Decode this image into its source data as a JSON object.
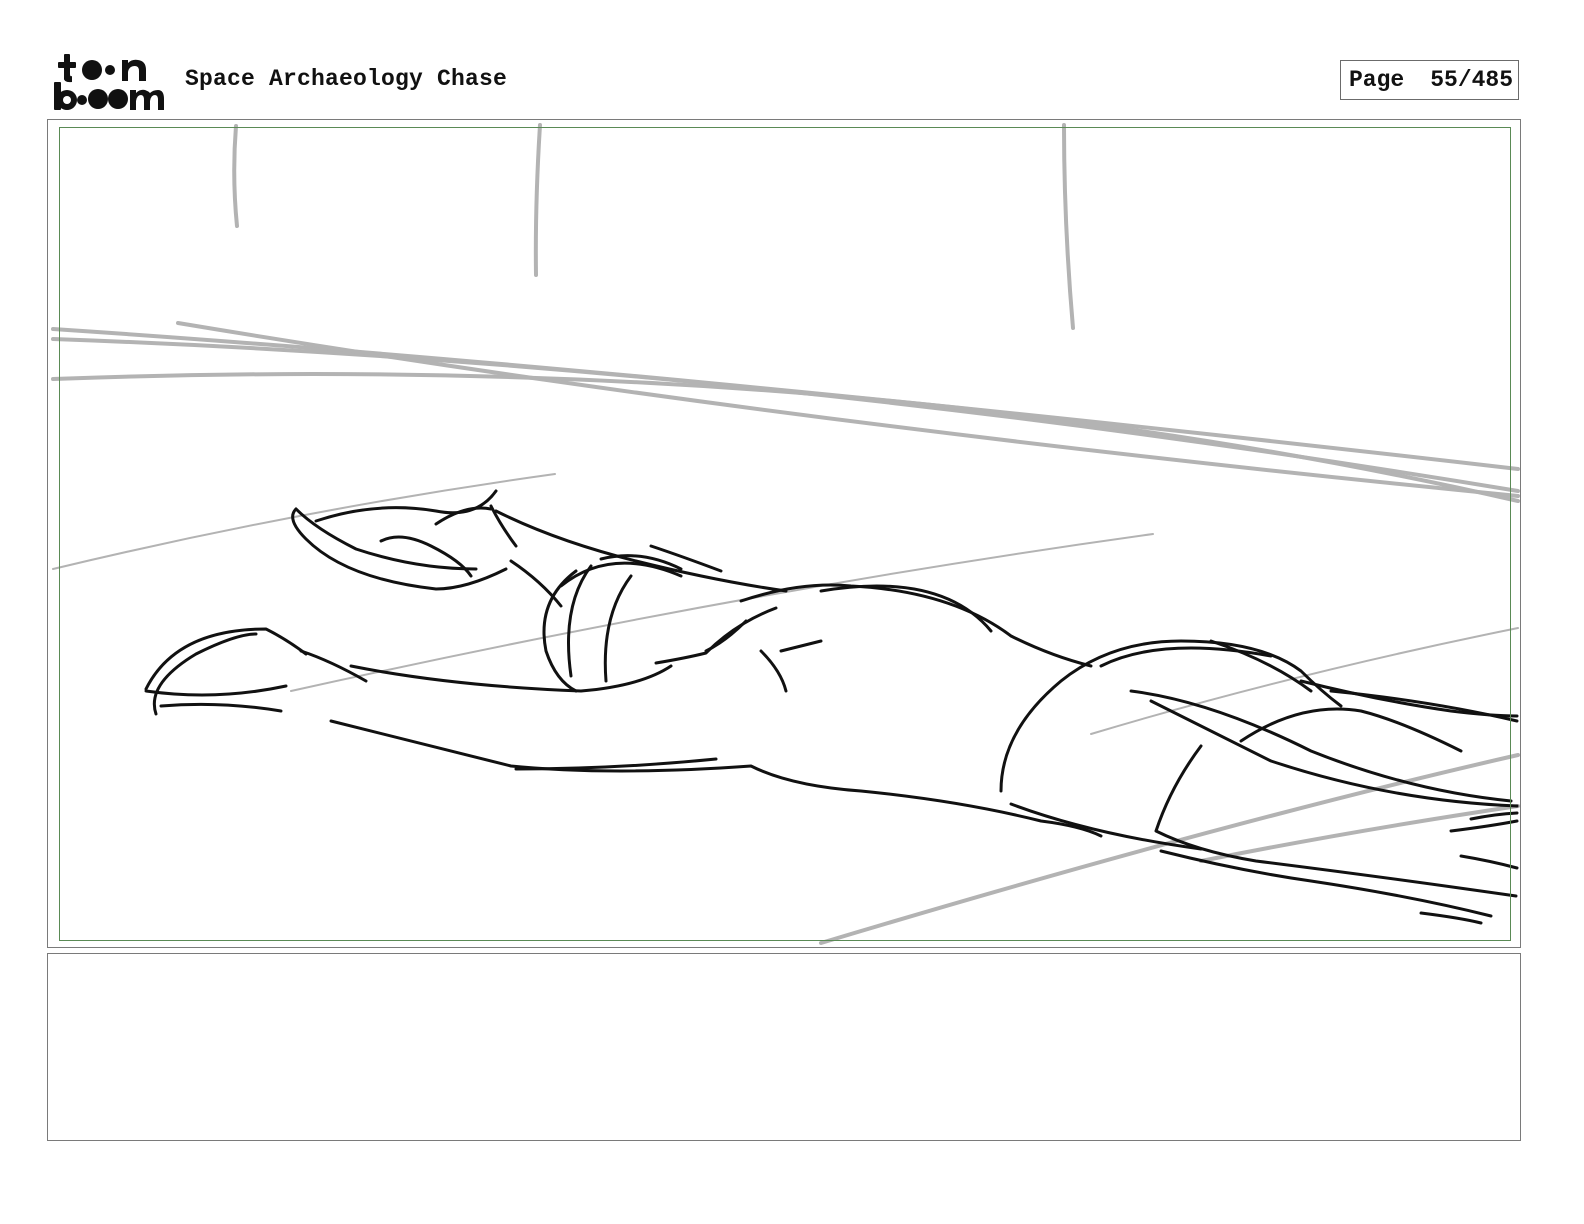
{
  "header": {
    "logo_text": "toon boom",
    "project_title": "Space Archaeology Chase",
    "page_label": "Page",
    "page_number": "55/485"
  },
  "panel": {
    "content": "storyboard-sketch-figure-lying-prone",
    "colors": {
      "sketch_lines": "#111111",
      "background_lines": "#b3b3b3",
      "safe_area_border": "#5a8a55",
      "frame_border": "#7a7a7a"
    }
  },
  "notes": {
    "text": ""
  }
}
